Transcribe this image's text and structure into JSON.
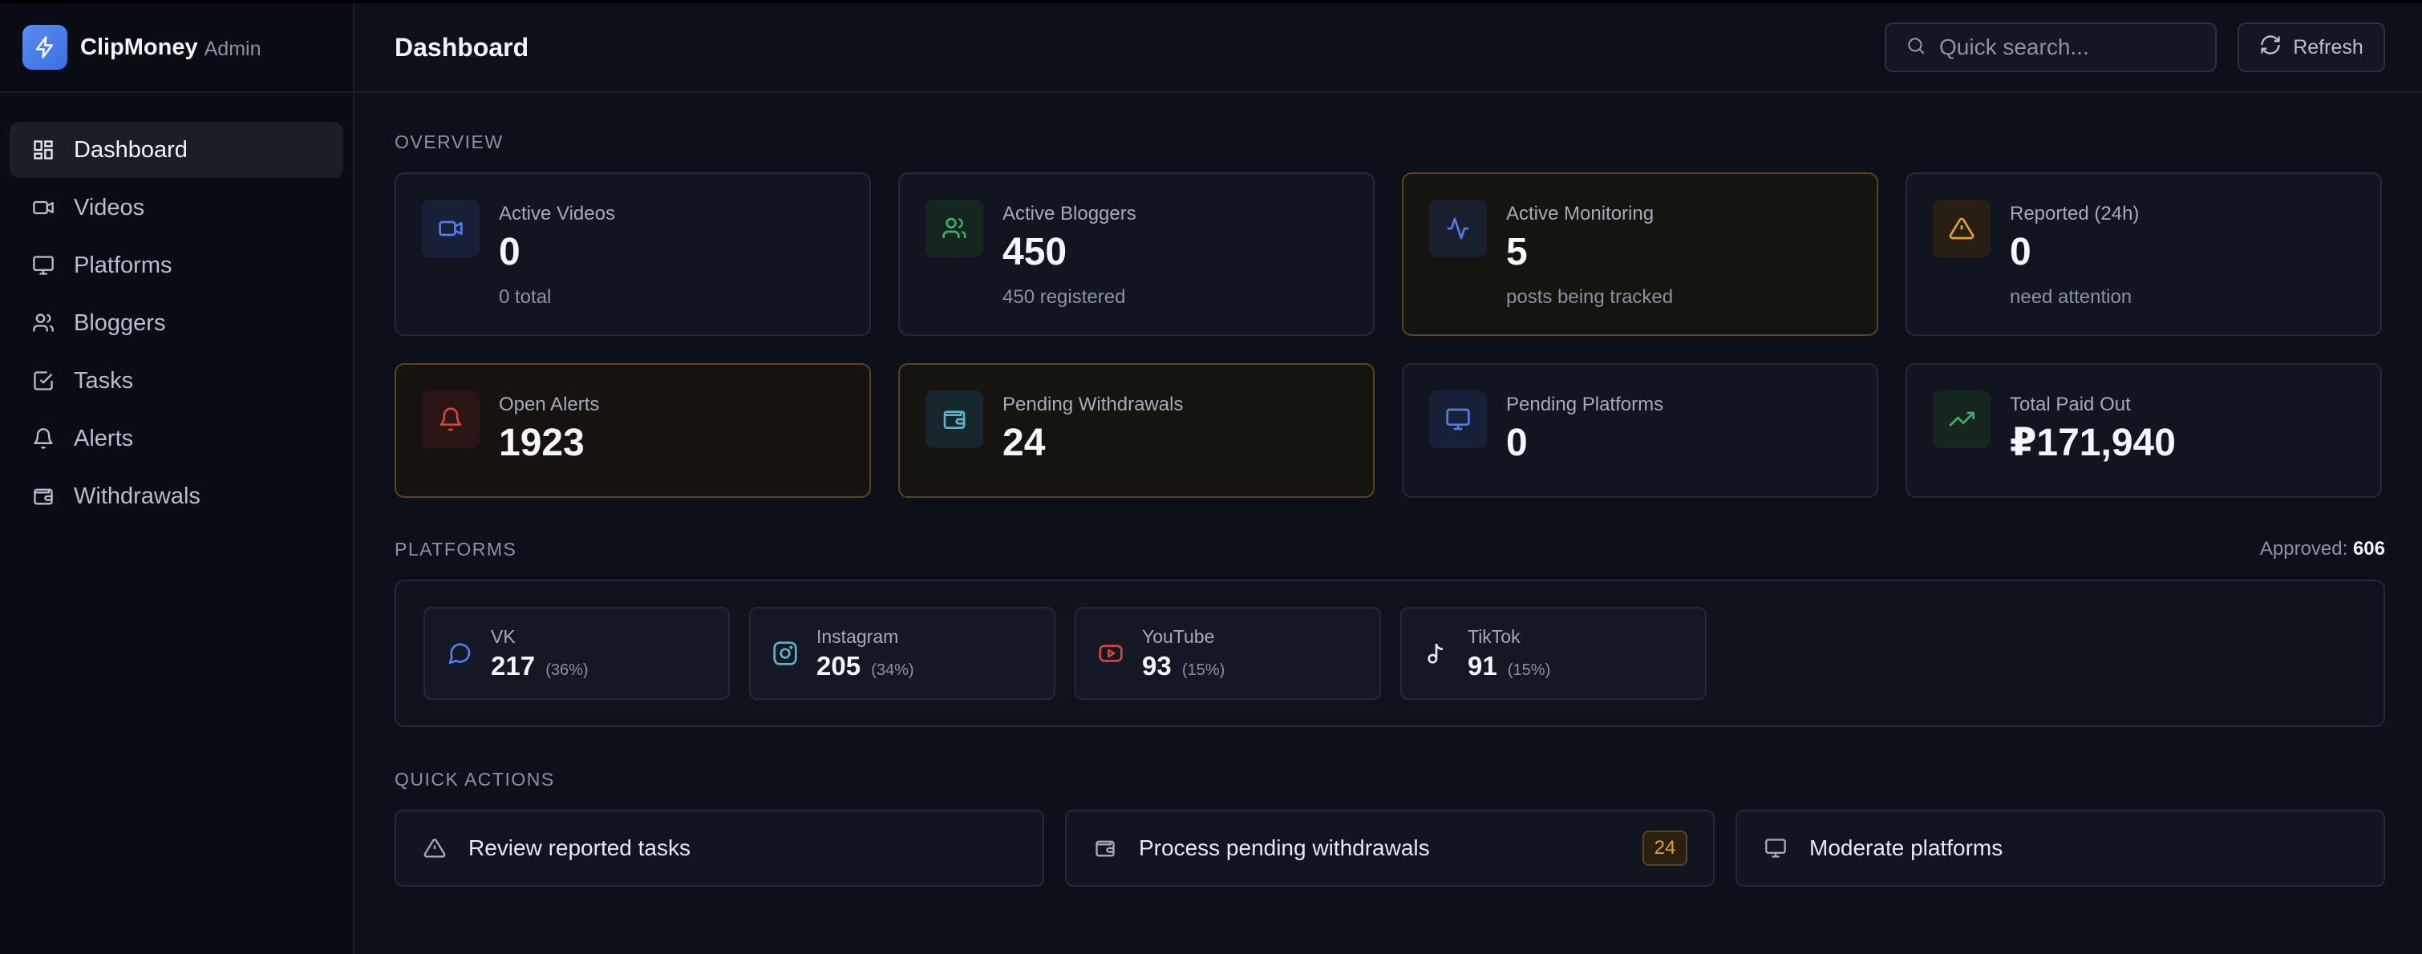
{
  "brand": {
    "name": "ClipMoney",
    "sub": "Admin"
  },
  "sidebar": {
    "items": [
      {
        "label": "Dashboard",
        "icon": "grid-icon"
      },
      {
        "label": "Videos",
        "icon": "video-icon"
      },
      {
        "label": "Platforms",
        "icon": "monitor-icon"
      },
      {
        "label": "Bloggers",
        "icon": "users-icon"
      },
      {
        "label": "Tasks",
        "icon": "checkbox-icon"
      },
      {
        "label": "Alerts",
        "icon": "bell-icon"
      },
      {
        "label": "Withdrawals",
        "icon": "wallet-icon"
      }
    ],
    "active": "Dashboard"
  },
  "header": {
    "title": "Dashboard",
    "search_placeholder": "Quick search...",
    "refresh_label": "Refresh"
  },
  "overview": {
    "label": "OVERVIEW",
    "cards": [
      {
        "label": "Active Videos",
        "value": "0",
        "sub": "0 total",
        "icon": "video-icon",
        "color": "#4f7ee8"
      },
      {
        "label": "Active Bloggers",
        "value": "450",
        "sub": "450 registered",
        "icon": "users-icon",
        "color": "#3fae6a"
      },
      {
        "label": "Active Monitoring",
        "value": "5",
        "sub": "posts being tracked",
        "icon": "activity-icon",
        "color": "#4f7ee8"
      },
      {
        "label": "Reported (24h)",
        "value": "0",
        "sub": "need attention",
        "icon": "alert-triangle-icon",
        "color": "#e0a030"
      },
      {
        "label": "Open Alerts",
        "value": "1923",
        "icon": "bell-icon",
        "color": "#d8443c"
      },
      {
        "label": "Pending Withdrawals",
        "value": "24",
        "icon": "wallet-icon",
        "color": "#5fb3c9"
      },
      {
        "label": "Pending Platforms",
        "value": "0",
        "icon": "monitor-icon",
        "color": "#4f7ee8"
      },
      {
        "label": "Total Paid Out",
        "value": "₽171,940",
        "icon": "trending-up-icon",
        "color": "#3fae6a"
      }
    ]
  },
  "platforms": {
    "label": "PLATFORMS",
    "approved_label": "Approved:",
    "approved_value": "606",
    "items": [
      {
        "name": "VK",
        "count": "217",
        "pct": "(36%)",
        "icon": "message-circle-icon",
        "color": "#4f7ee8"
      },
      {
        "name": "Instagram",
        "count": "205",
        "pct": "(34%)",
        "icon": "instagram-icon",
        "color": "#5fb3c9"
      },
      {
        "name": "YouTube",
        "count": "93",
        "pct": "(15%)",
        "icon": "youtube-icon",
        "color": "#d8443c"
      },
      {
        "name": "TikTok",
        "count": "91",
        "pct": "(15%)",
        "icon": "music-note-icon",
        "color": "#e6e9ef"
      }
    ]
  },
  "quick_actions": {
    "label": "QUICK ACTIONS",
    "items": [
      {
        "label": "Review reported tasks",
        "icon": "alert-triangle-icon"
      },
      {
        "label": "Process pending withdrawals",
        "icon": "wallet-icon",
        "badge": "24"
      },
      {
        "label": "Moderate platforms",
        "icon": "monitor-icon"
      }
    ]
  }
}
